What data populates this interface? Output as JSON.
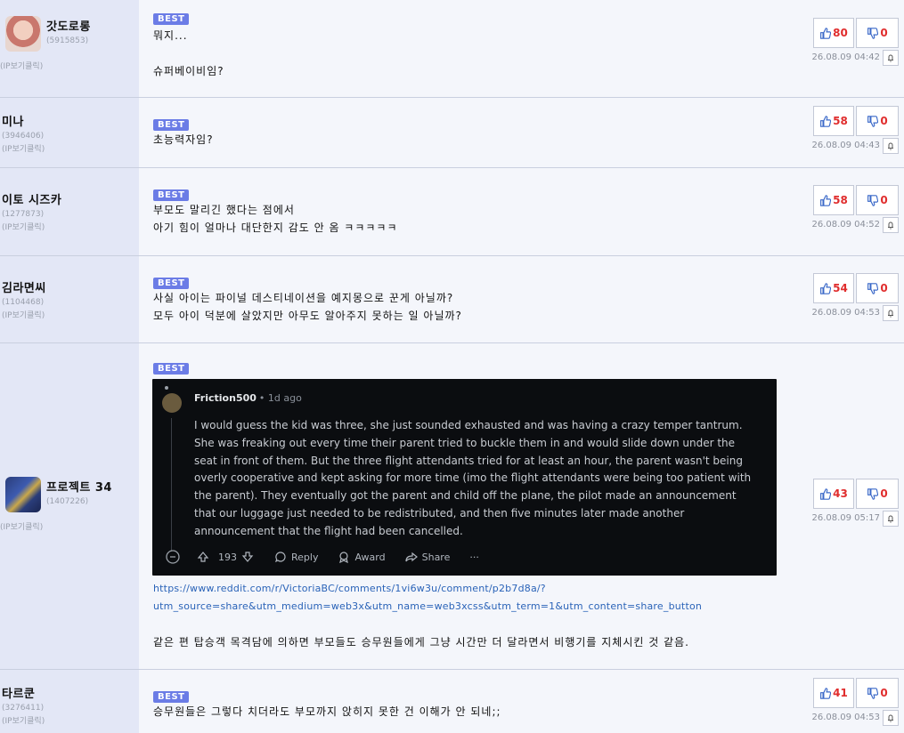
{
  "comments": [
    {
      "nick": "갓도로롱",
      "uid": "(5915853)",
      "ip_label": "(IP보기클릭)",
      "badge": "BEST",
      "lines": [
        "뭐지...",
        "",
        "슈퍼베이비임?"
      ],
      "up": "80",
      "down": "0",
      "date": "26.08.09 04:42"
    },
    {
      "nick": "미나",
      "uid": "(3946406)",
      "ip_label": "(IP보기클릭)",
      "badge": "BEST",
      "lines": [
        "초능력자임?"
      ],
      "up": "58",
      "down": "0",
      "date": "26.08.09 04:43"
    },
    {
      "nick": "이토 시즈카",
      "uid": "(1277873)",
      "ip_label": "(IP보기클릭)",
      "badge": "BEST",
      "lines": [
        "부모도 말리긴 했다는 점에서",
        "아기 힘이 얼마나 대단한지 감도 안 옴 ㅋㅋㅋㅋㅋ"
      ],
      "up": "58",
      "down": "0",
      "date": "26.08.09 04:52"
    },
    {
      "nick": "김라면씨",
      "uid": "(1104468)",
      "ip_label": "(IP보기클릭)",
      "badge": "BEST",
      "lines": [
        "사실 아이는 파이널 데스티네이션을 예지몽으로 꾼게 아닐까?",
        "모두 아이 덕분에 살았지만 아무도 알아주지 못하는 일 아닐까?"
      ],
      "up": "54",
      "down": "0",
      "date": "26.08.09 04:53"
    },
    {
      "nick": "프로젝트 34",
      "uid": "(1407226)",
      "ip_label": "(IP보기클릭)",
      "badge": "BEST",
      "embed": {
        "author": "Friction500",
        "ago": "• 1d ago",
        "body": "I would guess the kid was three, she just sounded exhausted and was having a crazy temper tantrum. She was freaking out every time their parent tried to buckle them in and would slide down under the seat in front of them. But the three flight attendants tried for at least an hour, the parent wasn't being overly cooperative and kept asking for more time (imo the flight attendants were being too patient with the parent). They eventually got the parent and child off the plane, the pilot made an announcement that our luggage just needed to be redistributed, and then five minutes later made another announcement that the flight had been cancelled.",
        "votes": "193",
        "reply": "Reply",
        "award": "Award",
        "share": "Share",
        "more": "···"
      },
      "link1": "https://www.reddit.com/r/VictoriaBC/comments/1vi6w3u/comment/p2b7d8a/?",
      "link2": "utm_source=share&utm_medium=web3x&utm_name=web3xcss&utm_term=1&utm_content=share_button",
      "after": "같은 편 탑승객 목격담에 의하면 부모들도 승무원들에게 그냥 시간만 더 달라면서 비행기를 지체시킨 것 같음.",
      "up": "43",
      "down": "0",
      "date": "26.08.09 05:17"
    },
    {
      "nick": "타르쿤",
      "uid": "(3276411)",
      "ip_label": "(IP보기클릭)",
      "badge": "BEST",
      "lines": [
        "승무원들은 그렇다 치더라도 부모까지 앉히지 못한 건 이해가 안 되네;;"
      ],
      "up": "41",
      "down": "0",
      "date": "26.08.09 04:53"
    }
  ],
  "colors": {
    "badge": "#6b7ce6",
    "vote_number": "#e02d2d",
    "thumb": "#3a68c8",
    "link": "#2a63b8"
  },
  "icons": [
    "thumbs-up-icon",
    "thumbs-down-icon",
    "bell-icon"
  ]
}
